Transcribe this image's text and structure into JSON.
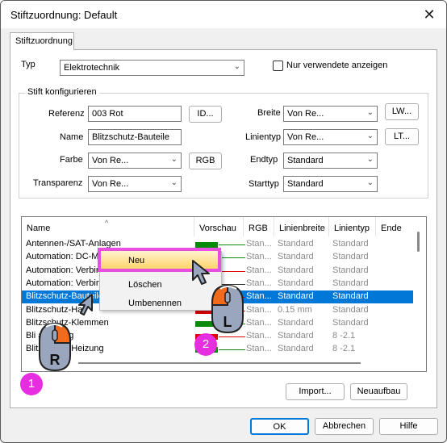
{
  "window": {
    "title": "Stiftzuordnung: Default",
    "close_glyph": "✕"
  },
  "tab": {
    "label": "Stiftzuordnung"
  },
  "type_row": {
    "label": "Typ",
    "value": "Elektrotechnik",
    "checkbox_label": "Nur verwendete anzeigen",
    "checkbox_checked": false
  },
  "pen_group": {
    "title": "Stift konfigurieren",
    "referenz_label": "Referenz",
    "referenz_value": "003  Rot",
    "id_button": "ID...",
    "name_label": "Name",
    "name_value": "Blitzschutz-Bauteile",
    "farbe_label": "Farbe",
    "farbe_value": "Von Re...",
    "rgb_button": "RGB",
    "transparenz_label": "Transparenz",
    "transparenz_value": "Von Re...",
    "breite_label": "Breite",
    "breite_value": "Von Re...",
    "lw_button": "LW...",
    "linientyp_label": "Linientyp",
    "linientyp_value": "Von Re...",
    "lt_button": "LT...",
    "endtyp_label": "Endtyp",
    "endtyp_value": "Standard",
    "starttyp_label": "Starttyp",
    "starttyp_value": "Standard"
  },
  "list": {
    "columns": [
      "Name",
      "Vorschau",
      "RGB",
      "Linienbreite",
      "Linientyp",
      "Ende"
    ],
    "rows": [
      {
        "name": "Antennen-/SAT-Anlagen",
        "color": "#0a8a0a",
        "rgb": "Stan...",
        "width": "Standard",
        "type": "Standard",
        "selected": false
      },
      {
        "name": "Automation: DC-Ma",
        "color": "#0a8a0a",
        "rgb": "Stan...",
        "width": "Standard",
        "type": "Standard",
        "selected": false
      },
      {
        "name": "Automation: Verbin",
        "color": "#e00000",
        "rgb": "Stan...",
        "width": "Standard",
        "type": "Standard",
        "selected": false
      },
      {
        "name": "Automation: Verbin",
        "color": "#333333",
        "rgb": "Stan...",
        "width": "Standard",
        "type": "Standard",
        "selected": false
      },
      {
        "name": "Blitzschutz-Bauteile",
        "color": "#e00000",
        "rgb": "Stan...",
        "width": "Standard",
        "type": "Standard",
        "selected": true
      },
      {
        "name": "Blitzschutz-Ha",
        "color": "#e00000",
        "rgb": "Stan...",
        "width": "0.15 mm",
        "type": "Standard",
        "selected": false
      },
      {
        "name": "Blitzschutz-Klemmen",
        "color": "#0a8a0a",
        "rgb": "Stan...",
        "width": "Standard",
        "type": "Standard",
        "selected": false
      },
      {
        "name": "Bli         asleitung",
        "color": "#e00000",
        "rgb": "Stan...",
        "width": "Standard",
        "type": "8 -2.1",
        "selected": false
      },
      {
        "name": "Blitzschutz-Heizung",
        "color": "#0a8a0a",
        "rgb": "Stan...",
        "width": "Standard",
        "type": "8 -2.1",
        "selected": false
      }
    ]
  },
  "context_menu": {
    "items": [
      "Neu",
      "Löschen",
      "Umbenennen"
    ]
  },
  "annotations": {
    "badge1": "1",
    "badge2": "2",
    "mouse_right_letter": "R",
    "mouse_left_letter": "L"
  },
  "buttons": {
    "import": "Import...",
    "rebuild": "Neuaufbau",
    "ok": "OK",
    "cancel": "Abbrechen",
    "help": "Hilfe"
  },
  "colors": {
    "selection": "#0078d7",
    "annotation_magenta": "#e62ee0",
    "highlight": "#ffd56a",
    "mouse_orange": "#f26a1b"
  }
}
